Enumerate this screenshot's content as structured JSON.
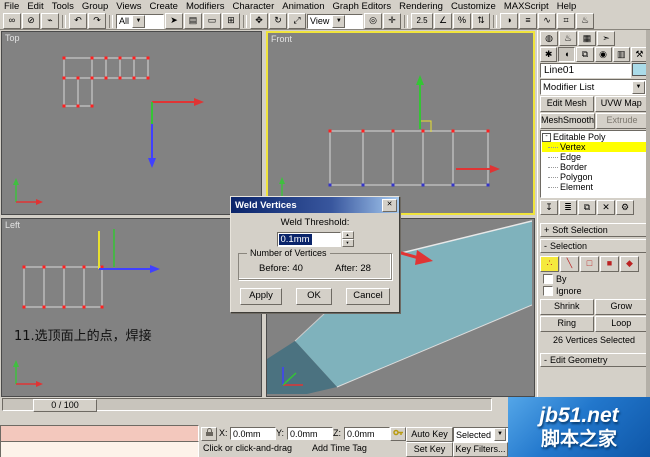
{
  "menu": {
    "items": [
      "File",
      "Edit",
      "Tools",
      "Group",
      "Views",
      "Create",
      "Modifiers",
      "Character",
      "Animation",
      "Graph Editors",
      "Rendering",
      "Customize",
      "MAXScript",
      "Help"
    ]
  },
  "ui": {
    "dropdown": "▼",
    "spin_up": "▲",
    "spin_down": "▼",
    "collapse": "-"
  },
  "toolbar": {
    "selection_filter": "All",
    "coord_system": "View",
    "icons": [
      {
        "name": "link-icon",
        "glyph": "∞"
      },
      {
        "name": "unlink-icon",
        "glyph": "⊘"
      },
      {
        "name": "bind-spacewarp-icon",
        "glyph": "⌁"
      },
      {
        "name": "undo-icon",
        "glyph": "↶"
      },
      {
        "name": "redo-icon",
        "glyph": "↷"
      },
      {
        "name": "select-object-icon",
        "glyph": "➤"
      },
      {
        "name": "select-by-name-icon",
        "glyph": "▤"
      },
      {
        "name": "region-select-icon",
        "glyph": "▭"
      },
      {
        "name": "window-crossing-icon",
        "glyph": "⊞"
      },
      {
        "name": "select-move-icon",
        "glyph": "✥"
      },
      {
        "name": "select-rotate-icon",
        "glyph": "↻"
      },
      {
        "name": "select-scale-icon",
        "glyph": "⤢"
      },
      {
        "name": "use-center-icon",
        "glyph": "◎"
      },
      {
        "name": "manipulate-icon",
        "glyph": "✛"
      },
      {
        "name": "snap-toggle-icon",
        "glyph": "2.5"
      },
      {
        "name": "angle-snap-icon",
        "glyph": "∠"
      },
      {
        "name": "percent-snap-icon",
        "glyph": "%"
      },
      {
        "name": "spinner-snap-icon",
        "glyph": "⇅"
      },
      {
        "name": "mirror-icon",
        "glyph": "◑"
      },
      {
        "name": "align-icon",
        "glyph": "≡"
      },
      {
        "name": "curve-editor-icon",
        "glyph": "∿"
      },
      {
        "name": "schematic-view-icon",
        "glyph": "⌗"
      },
      {
        "name": "render-scene-icon",
        "glyph": "♨"
      }
    ]
  },
  "viewports": {
    "top": "Top",
    "front": "Front",
    "left": "Left",
    "annotation": "11.选顶面上的点，焊接"
  },
  "dialog": {
    "title": "Weld Vertices",
    "close_glyph": "✕",
    "threshold_label": "Weld Threshold:",
    "threshold_value": "0.1mm",
    "group_label": "Number of Vertices",
    "before": "Before: 40",
    "after": "After: 28",
    "buttons": {
      "apply": "Apply",
      "ok": "OK",
      "cancel": "Cancel"
    }
  },
  "panel": {
    "top_icons": [
      {
        "name": "material-editor-icon",
        "glyph": "◍"
      },
      {
        "name": "render-scene-icon",
        "glyph": "♨"
      },
      {
        "name": "render-type-icon",
        "glyph": "▦"
      },
      {
        "name": "quick-render-icon",
        "glyph": "➣"
      }
    ],
    "tabs": [
      {
        "name": "create",
        "glyph": "✱"
      },
      {
        "name": "modify",
        "glyph": "◖"
      },
      {
        "name": "hierarchy",
        "glyph": "⧉"
      },
      {
        "name": "motion",
        "glyph": "◉"
      },
      {
        "name": "display",
        "glyph": "▥"
      },
      {
        "name": "utilities",
        "glyph": "⚒"
      }
    ],
    "object_name": "Line01",
    "modifier_list": "Modifier List",
    "modifier_buttons": [
      "Edit Mesh",
      "UVW Map",
      "MeshSmooth",
      "Extrude"
    ],
    "stack": {
      "root": "Editable Poly",
      "items": [
        "Vertex",
        "Edge",
        "Border",
        "Polygon",
        "Element"
      ],
      "selected": "Vertex"
    },
    "stack_icons": [
      {
        "name": "pin-stack-icon",
        "glyph": "↧"
      },
      {
        "name": "show-end-result-icon",
        "glyph": "≣"
      },
      {
        "name": "make-unique-icon",
        "glyph": "⧉"
      },
      {
        "name": "remove-modifier-icon",
        "glyph": "✕"
      },
      {
        "name": "configure-icon",
        "glyph": "⚙"
      }
    ],
    "rollouts": {
      "soft": {
        "prefix": "+",
        "label": "Soft Selection"
      },
      "selection": {
        "prefix": "-",
        "label": "Selection"
      },
      "edit_geometry": {
        "prefix": "-",
        "label": "Edit Geometry"
      }
    },
    "subobject_icons": [
      {
        "name": "vertex-icon",
        "glyph": "∴"
      },
      {
        "name": "edge-icon",
        "glyph": "╲"
      },
      {
        "name": "border-icon",
        "glyph": "□"
      },
      {
        "name": "polygon-icon",
        "glyph": "■"
      },
      {
        "name": "element-icon",
        "glyph": "◆"
      }
    ],
    "by_label": "By",
    "ignore_label": "Ignore",
    "buttons": {
      "shrink": "Shrink",
      "grow": "Grow",
      "ring": "Ring",
      "loop": "Loop"
    },
    "selected_status": "26 Vertices Selected"
  },
  "timeline": {
    "handle": "0 / 100"
  },
  "statusbar": {
    "x_label": "X:",
    "x_value": "0.0mm",
    "y_label": "Y:",
    "y_value": "0.0mm",
    "z_label": "Z:",
    "z_value": "0.0mm",
    "prompt": "Click or click-and-drag",
    "time_tag": "Add Time Tag",
    "auto_key": "Auto Key",
    "selected_filter": "Selected",
    "set_key": "Set Key",
    "key_filters": "Key Filters..."
  },
  "watermark": {
    "site": "jb51.net",
    "name": "脚本之家"
  }
}
